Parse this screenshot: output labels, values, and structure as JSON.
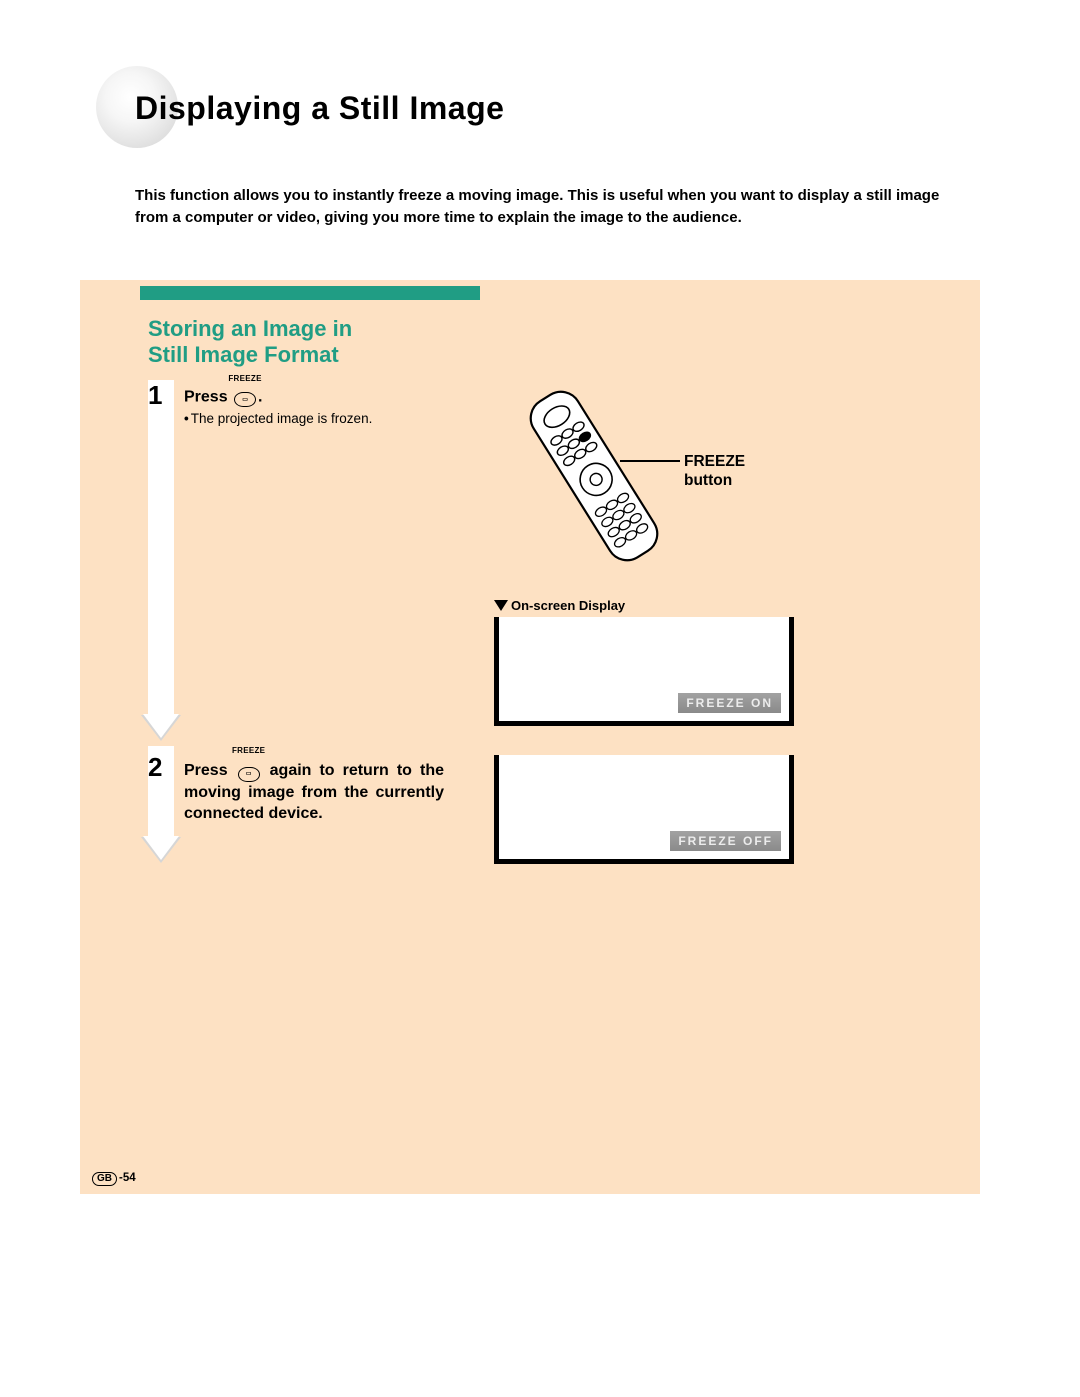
{
  "title": "Displaying a Still Image",
  "intro": "This function allows you to instantly freeze a moving image. This is useful when you want to display a still image from a computer or video, giving you more time to explain the image to the audience.",
  "subheading_l1": "Storing an Image in",
  "subheading_l2": "Still Image Format",
  "step1": {
    "num": "1",
    "press": "Press",
    "icon_label": "FREEZE",
    "after_icon": ".",
    "bullet": "The projected image is frozen."
  },
  "step2": {
    "num": "2",
    "press": "Press",
    "icon_label": "FREEZE",
    "rest": " again to return to the moving image from the cur­rently connected device."
  },
  "remote_callout_l1": "FREEZE",
  "remote_callout_l2": "button",
  "osd_label": "On-screen Display",
  "osd_on": "FREEZE ON",
  "osd_off": "FREEZE OFF",
  "page_region": "GB",
  "page_num": "-54"
}
